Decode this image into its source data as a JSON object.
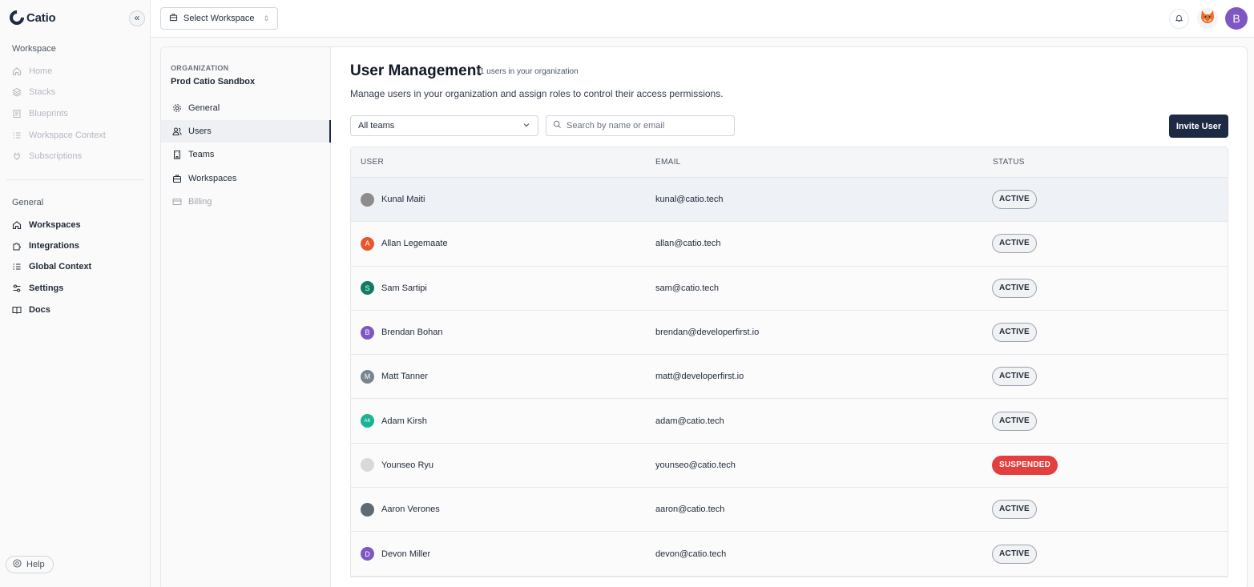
{
  "app": {
    "name": "Catio"
  },
  "sidebar": {
    "workspace_section": "Workspace",
    "workspace_items": [
      {
        "label": "Home",
        "icon": "home-icon"
      },
      {
        "label": "Stacks",
        "icon": "layers-icon"
      },
      {
        "label": "Blueprints",
        "icon": "blueprint-icon"
      },
      {
        "label": "Workspace Context",
        "icon": "list-icon"
      },
      {
        "label": "Subscriptions",
        "icon": "plug-icon"
      }
    ],
    "general_section": "General",
    "general_items": [
      {
        "label": "Workspaces",
        "icon": "home-icon"
      },
      {
        "label": "Integrations",
        "icon": "puzzle-icon"
      },
      {
        "label": "Global Context",
        "icon": "list-icon"
      },
      {
        "label": "Settings",
        "icon": "sliders-icon"
      },
      {
        "label": "Docs",
        "icon": "book-icon"
      }
    ],
    "help_label": "Help"
  },
  "topbar": {
    "workspace_select": "Select Workspace",
    "user_initial": "B"
  },
  "org_nav": {
    "section_label": "ORGANIZATION",
    "org_name": "Prod Catio Sandbox",
    "items": [
      {
        "label": "General",
        "icon": "gear-icon"
      },
      {
        "label": "Users",
        "icon": "users-icon"
      },
      {
        "label": "Teams",
        "icon": "building-icon"
      },
      {
        "label": "Workspaces",
        "icon": "briefcase-icon"
      },
      {
        "label": "Billing",
        "icon": "card-icon"
      }
    ]
  },
  "main": {
    "title": "User Management",
    "user_count": "11 users in your organization",
    "description": "Manage users in your organization and assign roles to control their access permissions.",
    "team_filter": "All teams",
    "search_placeholder": "Search by name or email",
    "invite_label": "Invite User"
  },
  "table": {
    "headers": {
      "user": "USER",
      "email": "EMAIL",
      "status": "STATUS"
    },
    "rows": [
      {
        "name": "Kunal Maiti",
        "email": "kunal@catio.tech",
        "status": "ACTIVE",
        "initial": "",
        "avatar_color": "#8d8d8d"
      },
      {
        "name": "Allan Legemaate",
        "email": "allan@catio.tech",
        "status": "ACTIVE",
        "initial": "A",
        "avatar_color": "#e8572a"
      },
      {
        "name": "Sam Sartipi",
        "email": "sam@catio.tech",
        "status": "ACTIVE",
        "initial": "S",
        "avatar_color": "#0f7b64"
      },
      {
        "name": "Brendan Bohan",
        "email": "brendan@developerfirst.io",
        "status": "ACTIVE",
        "initial": "B",
        "avatar_color": "#7e57c2"
      },
      {
        "name": "Matt Tanner",
        "email": "matt@developerfirst.io",
        "status": "ACTIVE",
        "initial": "M",
        "avatar_color": "#78858f"
      },
      {
        "name": "Adam Kirsh",
        "email": "adam@catio.tech",
        "status": "ACTIVE",
        "initial": "AK",
        "avatar_color": "#1ab394"
      },
      {
        "name": "Younseo Ryu",
        "email": "younseo@catio.tech",
        "status": "SUSPENDED",
        "initial": "",
        "avatar_color": "#d9d9d9"
      },
      {
        "name": "Aaron Verones",
        "email": "aaron@catio.tech",
        "status": "ACTIVE",
        "initial": "",
        "avatar_color": "#5f6b74"
      },
      {
        "name": "Devon Miller",
        "email": "devon@catio.tech",
        "status": "ACTIVE",
        "initial": "D",
        "avatar_color": "#7e57c2"
      }
    ]
  },
  "colors": {
    "brand": "#1e2a44",
    "active_badge_border": "#9ca3af",
    "suspended_badge": "#e53e3e"
  }
}
